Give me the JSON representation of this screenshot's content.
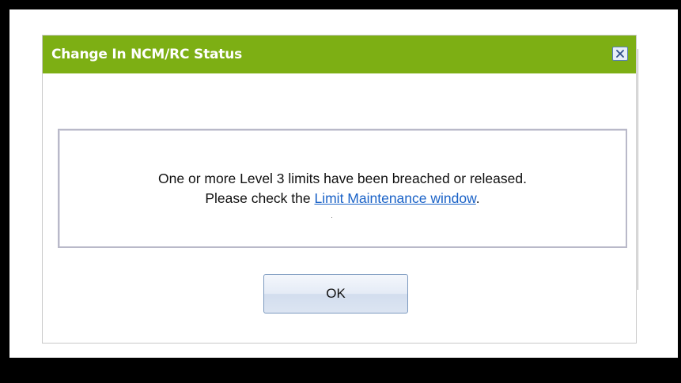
{
  "dialog": {
    "title": "Change In NCM/RC Status",
    "message_line1": "One or more Level 3 limits have been breached or released.",
    "message_line2_prefix": "Please check the ",
    "link_text": "Limit Maintenance window",
    "message_line2_suffix": ".",
    "ok_label": "OK",
    "close_icon": "close-icon"
  },
  "colors": {
    "titlebar": "#7daf14",
    "link": "#1a62c7",
    "background": "#000000"
  }
}
